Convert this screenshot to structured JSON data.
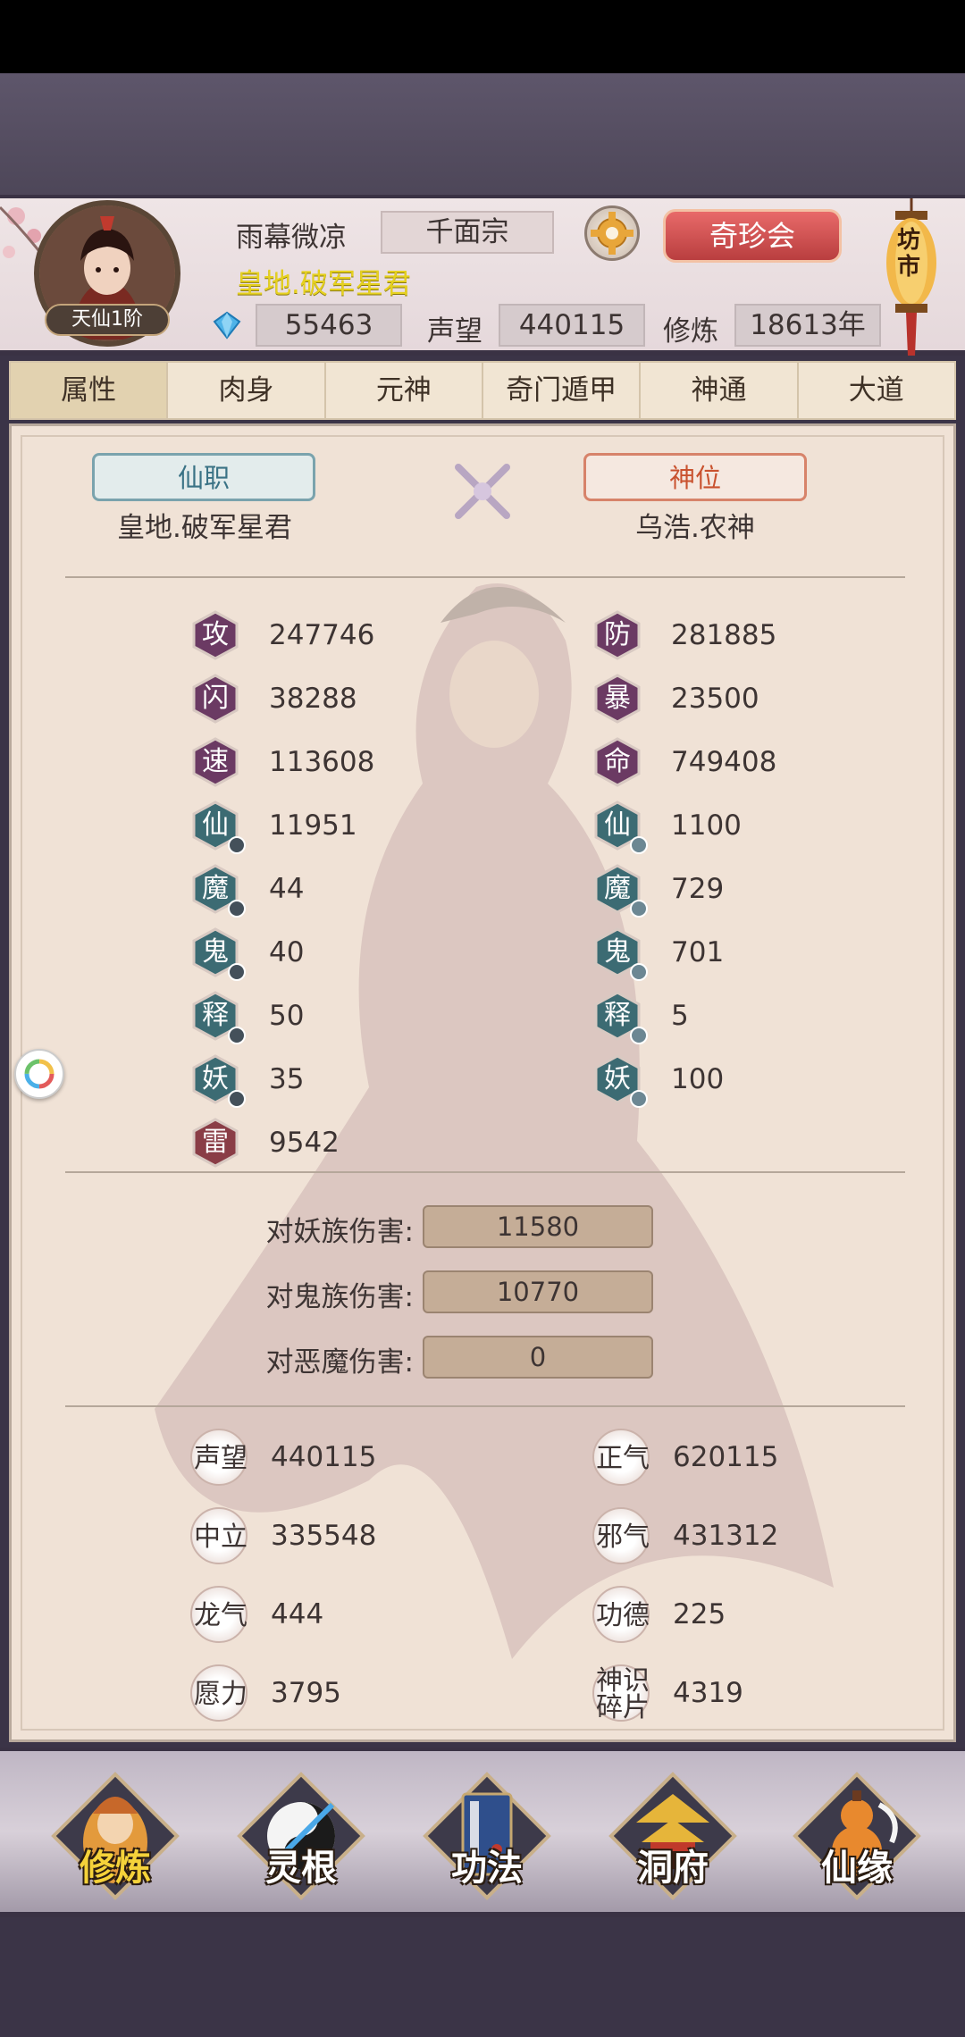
{
  "header": {
    "player_name": "雨幕微凉",
    "sect": "千面宗",
    "title": "皇地.破军星君",
    "realm": "天仙1阶",
    "treasure_button": "奇珍会",
    "market_label": "坊市",
    "currencies": {
      "gems": "55463",
      "reputation_label": "声望",
      "reputation": "440115",
      "cultivation_label": "修炼",
      "cultivation": "18613年"
    }
  },
  "tabs": [
    "属性",
    "肉身",
    "元神",
    "奇门遁甲",
    "神通",
    "大道"
  ],
  "positions": {
    "immortal_post_label": "仙职",
    "immortal_post_value": "皇地.破军星君",
    "god_post_label": "神位",
    "god_post_value": "乌浩.农神"
  },
  "stats_left": [
    {
      "label": "攻",
      "value": "247746",
      "color": "#6b3a63"
    },
    {
      "label": "闪",
      "value": "38288",
      "color": "#6b3a63"
    },
    {
      "label": "速",
      "value": "113608",
      "color": "#6b3a63"
    },
    {
      "label": "仙",
      "value": "11951",
      "color": "#3c6b73"
    },
    {
      "label": "魔",
      "value": "44",
      "color": "#3c6b73"
    },
    {
      "label": "鬼",
      "value": "40",
      "color": "#3c6b73"
    },
    {
      "label": "释",
      "value": "50",
      "color": "#3c6b73"
    },
    {
      "label": "妖",
      "value": "35",
      "color": "#3c6b73"
    },
    {
      "label": "雷",
      "value": "9542",
      "color": "#8a3d46"
    }
  ],
  "stats_right": [
    {
      "label": "防",
      "value": "281885",
      "color": "#6b3a63"
    },
    {
      "label": "暴",
      "value": "23500",
      "color": "#6b3a63"
    },
    {
      "label": "命",
      "value": "749408",
      "color": "#6b3a63"
    },
    {
      "label": "仙",
      "value": "1100",
      "color": "#3c6b73"
    },
    {
      "label": "魔",
      "value": "729",
      "color": "#3c6b73"
    },
    {
      "label": "鬼",
      "value": "701",
      "color": "#3c6b73"
    },
    {
      "label": "释",
      "value": "5",
      "color": "#3c6b73"
    },
    {
      "label": "妖",
      "value": "100",
      "color": "#3c6b73"
    }
  ],
  "damage": [
    {
      "label": "对妖族伤害:",
      "value": "11580"
    },
    {
      "label": "对鬼族伤害:",
      "value": "10770"
    },
    {
      "label": "对恶魔伤害:",
      "value": "0"
    }
  ],
  "resources_left": [
    {
      "label": "声望",
      "value": "440115"
    },
    {
      "label": "中立",
      "value": "335548"
    },
    {
      "label": "龙气",
      "value": "444"
    },
    {
      "label": "愿力",
      "value": "3795"
    }
  ],
  "resources_right": [
    {
      "label": "正气",
      "value": "620115"
    },
    {
      "label": "邪气",
      "value": "431312"
    },
    {
      "label": "功德",
      "value": "225"
    },
    {
      "label": "神识碎片",
      "value": "4319",
      "line1": "神识",
      "line2": "碎片"
    }
  ],
  "bottom_nav": [
    {
      "label": "修炼",
      "icon": "cultivate-icon"
    },
    {
      "label": "灵根",
      "icon": "spirit-root-icon"
    },
    {
      "label": "功法",
      "icon": "technique-book-icon"
    },
    {
      "label": "洞府",
      "icon": "cave-residence-icon"
    },
    {
      "label": "仙缘",
      "icon": "gourd-icon"
    }
  ],
  "colors": {
    "title_yellow": "#e6d11f",
    "treasure_red": "#c94b4b",
    "nav_active": "#f5d23a"
  }
}
